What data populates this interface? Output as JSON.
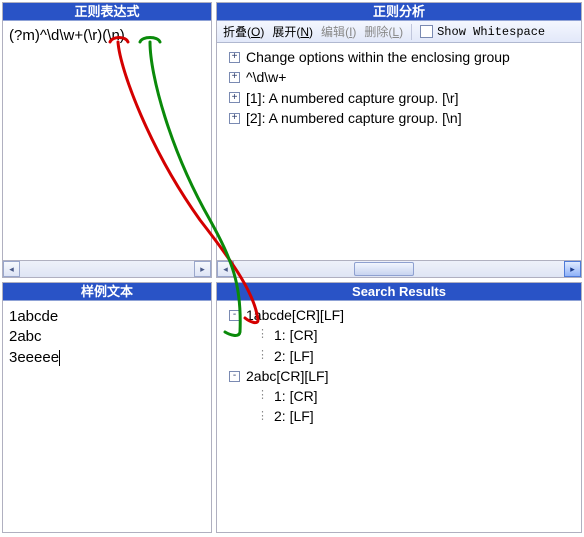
{
  "panels": {
    "regex": {
      "title": "正则表达式",
      "content": "(?m)^\\d\\w+(\\r)(\\n)"
    },
    "analysis": {
      "title": "正则分析",
      "toolbar": {
        "collapse": "折叠",
        "collapse_hk": "O",
        "expand": "展开",
        "expand_hk": "N",
        "edit": "编辑",
        "edit_hk": "I",
        "delete": "删除",
        "delete_hk": "L",
        "show_ws": "Show Whitespace"
      },
      "items": [
        {
          "expand": "+",
          "label": "Change options within the enclosing group"
        },
        {
          "expand": "+",
          "label": "^\\d\\w+"
        },
        {
          "expand": "+",
          "label": "[1]: A numbered capture group. [\\r]"
        },
        {
          "expand": "+",
          "label": "[2]: A numbered capture group. [\\n]"
        }
      ]
    },
    "sample": {
      "title": "样例文本",
      "lines": [
        "1abcde",
        "2abc",
        "3eeeee"
      ]
    },
    "results": {
      "title": "Search Results",
      "items": [
        {
          "expand": "-",
          "depth": 0,
          "label": "1abcde[CR][LF]"
        },
        {
          "expand": "",
          "depth": 1,
          "label": "1: [CR]"
        },
        {
          "expand": "",
          "depth": 1,
          "label": "2: [LF]"
        },
        {
          "expand": "-",
          "depth": 0,
          "label": "2abc[CR][LF]"
        },
        {
          "expand": "",
          "depth": 1,
          "label": "1: [CR]"
        },
        {
          "expand": "",
          "depth": 1,
          "label": "2: [LF]"
        }
      ]
    }
  }
}
